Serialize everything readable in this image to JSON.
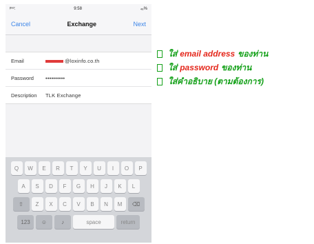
{
  "status_bar": {
    "carrier": "ᵖᵘᵒ:",
    "time": "9:58",
    "battery": "₄₈%"
  },
  "nav": {
    "cancel_label": "Cancel",
    "title": "Exchange",
    "next_label": "Next"
  },
  "form": {
    "email_label": "Email",
    "email_value": "@loxinfo.co.th",
    "password_label": "Password",
    "password_value": "••••••••••",
    "description_label": "Description",
    "description_value": "TLK Exchange"
  },
  "keyboard": {
    "row1": [
      "Q",
      "W",
      "E",
      "R",
      "T",
      "Y",
      "U",
      "I",
      "O",
      "P"
    ],
    "row2": [
      "A",
      "S",
      "D",
      "F",
      "G",
      "H",
      "J",
      "K",
      "L"
    ],
    "row3": [
      "Z",
      "X",
      "C",
      "V",
      "B",
      "N",
      "M"
    ],
    "numbers_key": "123",
    "space_key": "space",
    "return_key": "return"
  },
  "annotations": [
    {
      "prefix": "ใส่",
      "highlight": "email address",
      "suffix": "ของท่าน"
    },
    {
      "prefix": "ใส่",
      "highlight": "password",
      "suffix": "ของท่าน"
    },
    {
      "prefix": "ใส่คำอธิบาย (ตามต้องการ)",
      "highlight": "",
      "suffix": ""
    }
  ],
  "colors": {
    "accent": "#3d86e8",
    "annotation_green": "#15a11a",
    "annotation_red": "#e4271b"
  }
}
